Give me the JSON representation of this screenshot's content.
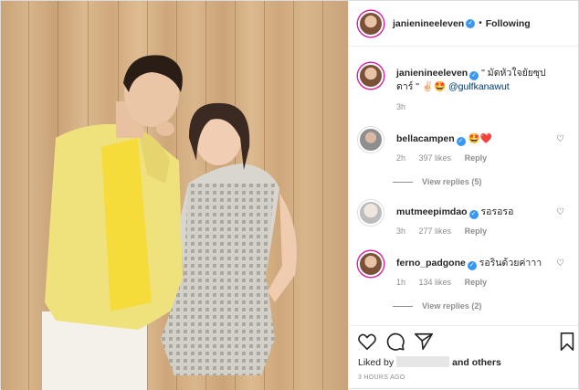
{
  "post": {
    "author": "janienineeleven",
    "header_separator": "•",
    "follow_status": "Following",
    "caption_text": "\" มัดหัวใจยัยซุปดาร์ \" ✌🏻🤩",
    "caption_mention": "@gulfkanawut",
    "caption_time": "3h",
    "liked_prefix": "Liked by",
    "liked_suffix": "and others",
    "posted_ago": "3 HOURS AGO"
  },
  "comments": [
    {
      "username": "bellacampen",
      "text": "🤩❤️",
      "time": "2h",
      "likes": "397 likes",
      "reply": "Reply"
    },
    {
      "view_replies": "View replies (5)"
    },
    {
      "username": "mutmeepimdao",
      "text": "รอรอรอ",
      "time": "3h",
      "likes": "277 likes",
      "reply": "Reply"
    },
    {
      "username": "ferno_padgone",
      "text": "รอรินด้วยค่าาา",
      "time": "1h",
      "likes": "134 likes",
      "reply": "Reply"
    },
    {
      "view_replies": "View replies (2)"
    }
  ],
  "icons": {
    "verified": "verified-badge-icon",
    "like": "heart-icon",
    "comment": "comment-bubble-icon",
    "share": "paper-plane-icon",
    "save": "bookmark-icon"
  },
  "colors": {
    "verified": "#3897f0",
    "link": "#00376b",
    "muted": "#8e8e8e",
    "border": "#efefef"
  }
}
